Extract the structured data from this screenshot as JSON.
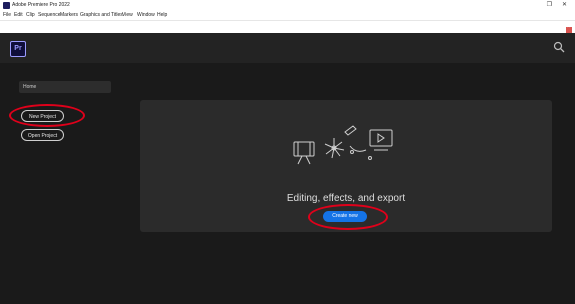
{
  "window": {
    "title": "Adobe Premiere Pro 2022",
    "restore_icon": "restore-icon",
    "close_icon": "close-icon"
  },
  "menu": [
    "File",
    "Edit",
    "Clip",
    "Sequence",
    "Markers",
    "Graphics and Titles",
    "View",
    "Window",
    "Help"
  ],
  "app": {
    "logo": "Pr",
    "search_icon": "search-icon"
  },
  "sidebar": {
    "home_label": "Home",
    "new_project_label": "New Project",
    "open_project_label": "Open Project"
  },
  "main": {
    "headline": "Editing, effects, and export",
    "create_button_label": "Create new"
  },
  "colors": {
    "app_background": "#1a1a1a",
    "panel_background": "#2b2b2b",
    "accent_blue": "#1473e6",
    "highlight_red": "#e0001a"
  }
}
